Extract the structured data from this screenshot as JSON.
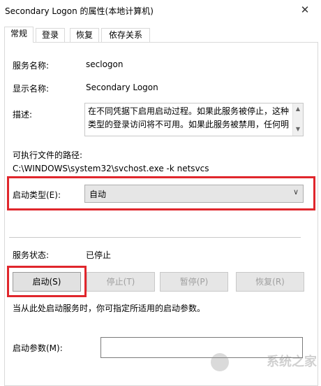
{
  "window": {
    "title": "Secondary Logon 的属性(本地计算机)",
    "close_icon": "close-icon"
  },
  "tabs": [
    {
      "label": "常规",
      "active": true
    },
    {
      "label": "登录",
      "active": false
    },
    {
      "label": "恢复",
      "active": false
    },
    {
      "label": "依存关系",
      "active": false
    }
  ],
  "general": {
    "service_name_label": "服务名称:",
    "service_name_value": "seclogon",
    "display_name_label": "显示名称:",
    "display_name_value": "Secondary Logon",
    "description_label": "描述:",
    "description_line1": "在不同凭据下启用启动过程。如果此服务被停止，这种",
    "description_line2": "类型的登录访问将不可用。如果此服务被禁用，任何明",
    "exe_path_label": "可执行文件的路径:",
    "exe_path_value": "C:\\WINDOWS\\system32\\svchost.exe -k netsvcs",
    "startup_type_label": "启动类型(E):",
    "startup_type_value": "自动",
    "service_status_label": "服务状态:",
    "service_status_value": "已停止",
    "start_button": "启动(S)",
    "stop_button": "停止(T)",
    "pause_button": "暂停(P)",
    "resume_button": "恢复(R)",
    "hint_text": "当从此处启动服务时，你可指定所适用的启动参数。",
    "start_params_label": "启动参数(M):",
    "start_params_value": ""
  },
  "watermark": {
    "text": "系统之家"
  },
  "colors": {
    "highlight": "#e0262c"
  }
}
